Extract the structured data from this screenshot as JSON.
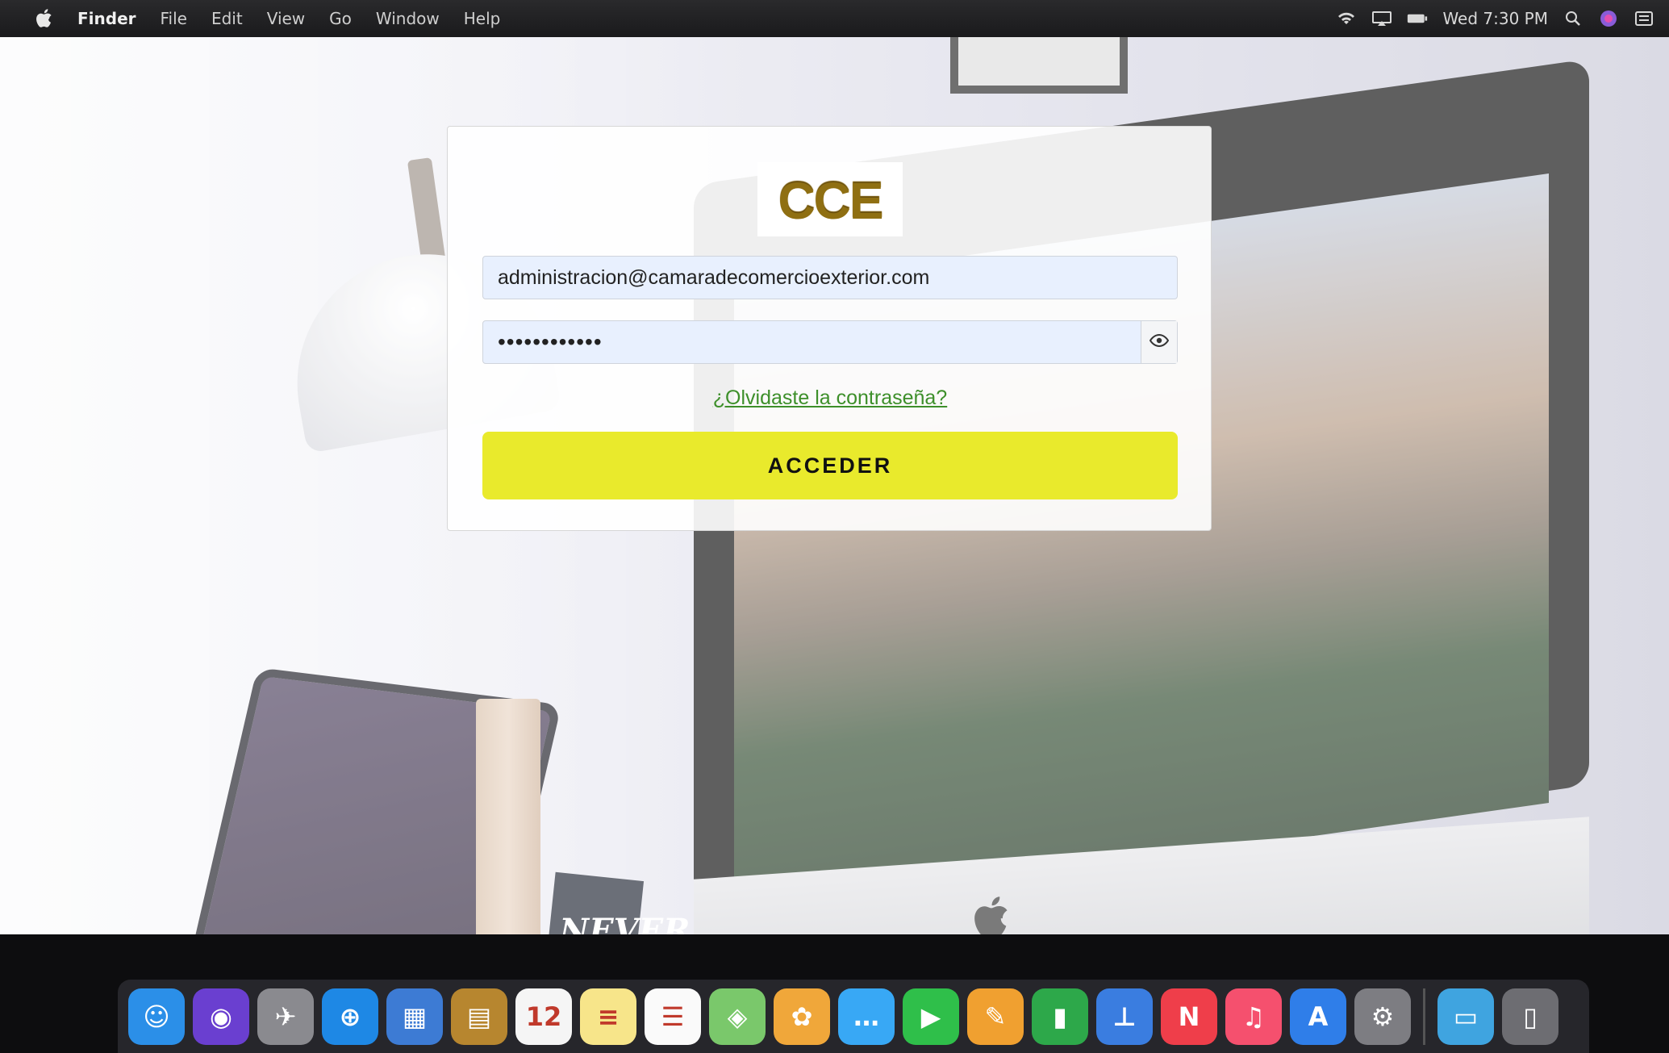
{
  "menubar": {
    "app_name": "Finder",
    "menus": [
      "File",
      "Edit",
      "View",
      "Go",
      "Window",
      "Help"
    ],
    "clock": "Wed 7:30 PM",
    "status_icons": [
      "wifi-icon",
      "airplay-icon",
      "battery-icon",
      "search-icon",
      "siri-icon",
      "control-center-icon"
    ]
  },
  "login": {
    "logo_text": "CCE",
    "email_value": "administracion@camaradecomercioexterior.com",
    "password_value": "••••••••••••",
    "forgot_link": "¿Olvidaste la contraseña?",
    "submit_label": "ACCEDER",
    "colors": {
      "button": "#e9ea2c",
      "link": "#3d8f2a",
      "input_bg": "#e8f0fe",
      "logo_gold": "#c9a227"
    }
  },
  "dock": {
    "apps": [
      {
        "name": "finder",
        "color": "#2b8fe8",
        "glyph": "☺"
      },
      {
        "name": "siri",
        "color": "#6a3fd0",
        "glyph": "◉"
      },
      {
        "name": "launchpad",
        "color": "#8a8a8f",
        "glyph": "✈"
      },
      {
        "name": "safari",
        "color": "#1e88e5",
        "glyph": "⊕"
      },
      {
        "name": "preview",
        "color": "#3d7bd4",
        "glyph": "▦"
      },
      {
        "name": "notebook",
        "color": "#b7862f",
        "glyph": "▤"
      },
      {
        "name": "calendar",
        "color": "#f5f5f5",
        "glyph": "12"
      },
      {
        "name": "notes",
        "color": "#f7e58a",
        "glyph": "≡"
      },
      {
        "name": "reminders",
        "color": "#fafafa",
        "glyph": "☰"
      },
      {
        "name": "maps",
        "color": "#7ac86b",
        "glyph": "◈"
      },
      {
        "name": "photos",
        "color": "#f0a73a",
        "glyph": "✿"
      },
      {
        "name": "messages",
        "color": "#38a8f5",
        "glyph": "…"
      },
      {
        "name": "facetime",
        "color": "#2fbf4a",
        "glyph": "▶"
      },
      {
        "name": "pages",
        "color": "#f0a030",
        "glyph": "✎"
      },
      {
        "name": "numbers",
        "color": "#2da84a",
        "glyph": "▮"
      },
      {
        "name": "keynote",
        "color": "#3a7de0",
        "glyph": "⊥"
      },
      {
        "name": "news",
        "color": "#ef3e4a",
        "glyph": "N"
      },
      {
        "name": "music",
        "color": "#f5506e",
        "glyph": "♫"
      },
      {
        "name": "app-store",
        "color": "#2f7ee9",
        "glyph": "A"
      },
      {
        "name": "system-preferences",
        "color": "#7d7d82",
        "glyph": "⚙"
      }
    ],
    "right_items": [
      {
        "name": "downloads-folder",
        "color": "#3fa4e0",
        "glyph": "▭"
      },
      {
        "name": "trash",
        "color": "#6d6d72",
        "glyph": "▯"
      }
    ]
  }
}
